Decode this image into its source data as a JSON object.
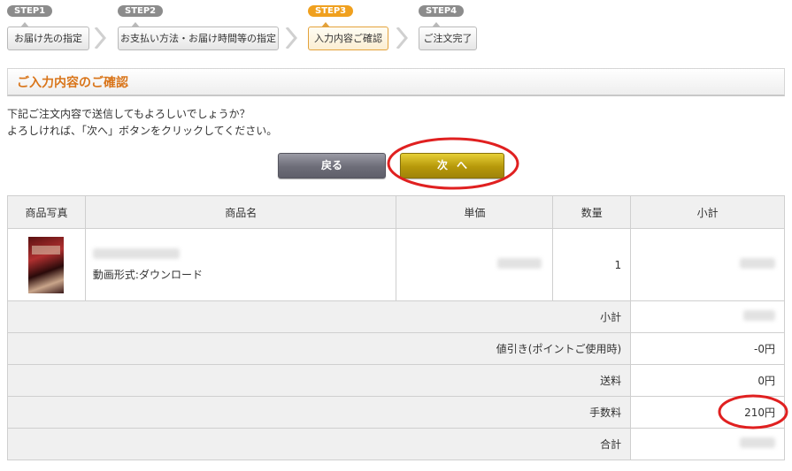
{
  "steps": [
    {
      "tag": "STEP1",
      "label": "お届け先の指定"
    },
    {
      "tag": "STEP2",
      "label": "お支払い方法・お届け時間等の指定"
    },
    {
      "tag": "STEP3",
      "label": "入力内容ご確認"
    },
    {
      "tag": "STEP4",
      "label": "ご注文完了"
    }
  ],
  "section_title": "ご入力内容のご確認",
  "message": {
    "line1": "下記ご注文内容で送信してもよろしいでしょうか？",
    "line2": "よろしければ、「次へ」ボタンをクリックしてください。"
  },
  "buttons": {
    "back": "戻る",
    "next": "次へ"
  },
  "table": {
    "headers": [
      "商品写真",
      "商品名",
      "単価",
      "数量",
      "小計"
    ],
    "item": {
      "format": "動画形式:ダウンロード",
      "quantity": "1"
    },
    "summary": [
      {
        "label": "小計",
        "value": ""
      },
      {
        "label": "値引き(ポイントご使用時)",
        "value": "-0円"
      },
      {
        "label": "送料",
        "value": "0円"
      },
      {
        "label": "手数料",
        "value": "210円"
      },
      {
        "label": "合計",
        "value": ""
      }
    ]
  },
  "colors": {
    "active_step": "#f0a01e",
    "heading": "#d9751a",
    "annotation": "#e02020"
  }
}
